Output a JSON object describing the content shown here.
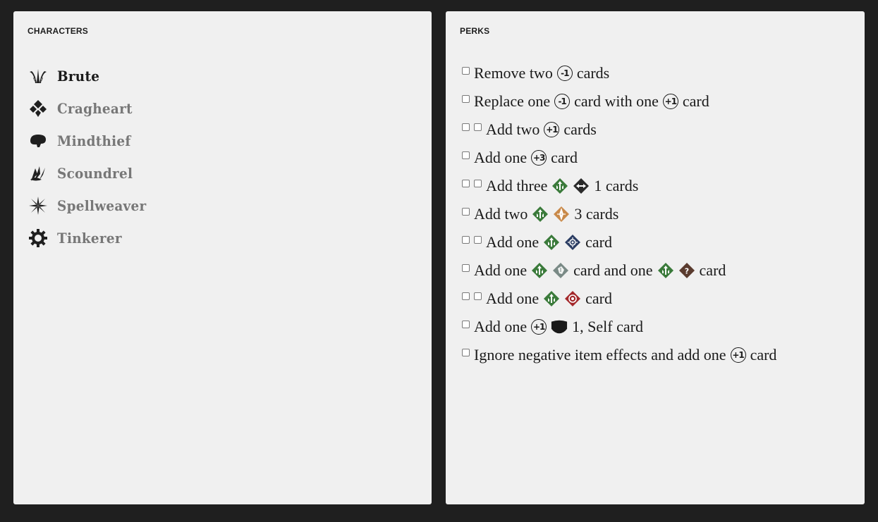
{
  "characters_panel": {
    "title": "CHARACTERS",
    "items": [
      {
        "name": "Brute",
        "icon": "brute-icon",
        "active": true
      },
      {
        "name": "Cragheart",
        "icon": "cragheart-icon",
        "active": false
      },
      {
        "name": "Mindthief",
        "icon": "mindthief-icon",
        "active": false
      },
      {
        "name": "Scoundrel",
        "icon": "scoundrel-icon",
        "active": false
      },
      {
        "name": "Spellweaver",
        "icon": "spellweaver-icon",
        "active": false
      },
      {
        "name": "Tinkerer",
        "icon": "tinkerer-icon",
        "active": false
      }
    ]
  },
  "perks_panel": {
    "title": "PERKS",
    "perks": [
      {
        "checkboxes": 1,
        "parts": [
          {
            "t": "Remove two"
          },
          {
            "mod": "-1"
          },
          {
            "t": "cards"
          }
        ]
      },
      {
        "checkboxes": 1,
        "parts": [
          {
            "t": "Replace one"
          },
          {
            "mod": "-1"
          },
          {
            "t": "card with one"
          },
          {
            "mod": "+1"
          },
          {
            "t": "card"
          }
        ]
      },
      {
        "checkboxes": 2,
        "parts": [
          {
            "t": "Add two"
          },
          {
            "mod": "+1"
          },
          {
            "t": "cards"
          }
        ]
      },
      {
        "checkboxes": 1,
        "parts": [
          {
            "t": "Add one"
          },
          {
            "mod": "+3"
          },
          {
            "t": "card"
          }
        ]
      },
      {
        "checkboxes": 2,
        "parts": [
          {
            "t": "Add three"
          },
          {
            "icon": "rolling-icon"
          },
          {
            "icon": "push-icon"
          },
          {
            "t": "1 cards"
          }
        ]
      },
      {
        "checkboxes": 1,
        "parts": [
          {
            "t": "Add two"
          },
          {
            "icon": "rolling-icon"
          },
          {
            "icon": "pierce-icon"
          },
          {
            "t": "3 cards"
          }
        ]
      },
      {
        "checkboxes": 2,
        "parts": [
          {
            "t": "Add one"
          },
          {
            "icon": "rolling-icon"
          },
          {
            "icon": "stun-icon"
          },
          {
            "t": "card"
          }
        ]
      },
      {
        "checkboxes": 1,
        "parts": [
          {
            "t": "Add one"
          },
          {
            "icon": "rolling-icon"
          },
          {
            "icon": "disarm-icon"
          },
          {
            "t": "card and one"
          },
          {
            "icon": "rolling-icon"
          },
          {
            "icon": "muddle-icon"
          },
          {
            "t": "card"
          }
        ]
      },
      {
        "checkboxes": 2,
        "parts": [
          {
            "t": "Add one"
          },
          {
            "icon": "rolling-icon"
          },
          {
            "icon": "target-icon"
          },
          {
            "t": "card"
          }
        ]
      },
      {
        "checkboxes": 1,
        "parts": [
          {
            "t": "Add one"
          },
          {
            "mod": "+1"
          },
          {
            "icon": "shield-icon"
          },
          {
            "t": "1, Self card"
          }
        ]
      },
      {
        "checkboxes": 1,
        "parts": [
          {
            "t": "Ignore negative item effects and add one"
          },
          {
            "mod": "+1"
          },
          {
            "t": "card"
          }
        ]
      }
    ]
  },
  "colors": {
    "background": "#1f1f1f",
    "panel": "#f0f0f0",
    "rolling": "#3a7a3a",
    "pierce": "#c98a4a",
    "stun": "#2b3d63",
    "target": "#a3282b",
    "muddle": "#5a3b2e"
  }
}
